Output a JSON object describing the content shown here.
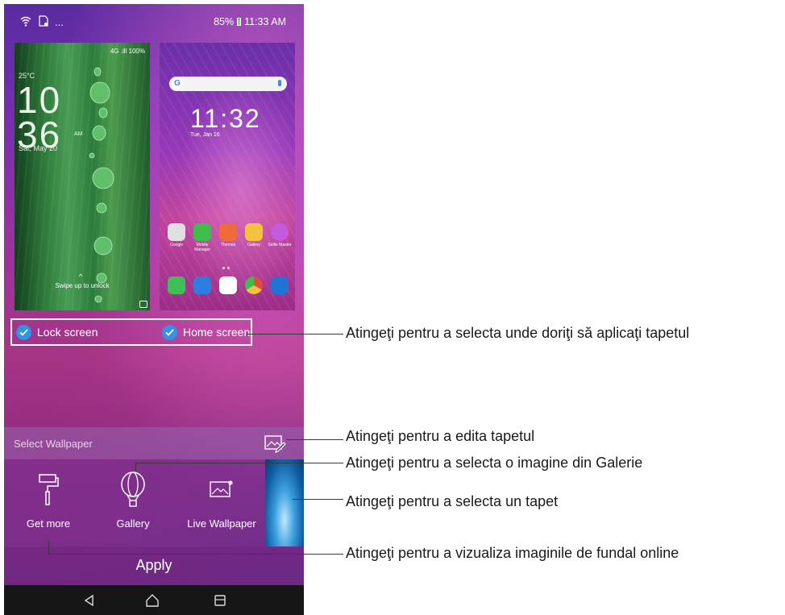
{
  "status_bar": {
    "left_icons": [
      "wifi-icon",
      "sd-card-icon",
      "more-icon"
    ],
    "more": "...",
    "battery": "85%",
    "time": "11:33 AM",
    "battery_color": "#7ee07a"
  },
  "lock_preview": {
    "status": "4G .ill 100%",
    "temperature": "25°C",
    "hour": "10",
    "minute": "36",
    "ampm": "AM",
    "date": "Sat, May 20",
    "unlock_hint": "Swipe up to unlock"
  },
  "home_preview": {
    "search_logo": "G",
    "clock": "11:32",
    "date": "Tue, Jan 16",
    "apps_row1": [
      {
        "label": "Google",
        "color": "#e0e0e0"
      },
      {
        "label": "Mobile Manager",
        "color": "#3ebd4c"
      },
      {
        "label": "Themes",
        "color": "#ef6b3a"
      },
      {
        "label": "Gallery",
        "color": "#f4c23f"
      },
      {
        "label": "Selfie Master",
        "color": "#c25be0"
      }
    ],
    "apps_row2": [
      {
        "label": "Phone",
        "color": "#3fbf58"
      },
      {
        "label": "Messages",
        "color": "#2f7de0"
      },
      {
        "label": "Play Store",
        "color": "#ffffff"
      },
      {
        "label": "Chrome",
        "color": "#e34b3b"
      },
      {
        "label": "Camera",
        "color": "#1f74d6"
      }
    ]
  },
  "targets": {
    "lock_label": "Lock screen",
    "home_label": "Home screen",
    "check_color": "#2f93e6"
  },
  "select_bar": {
    "label": "Select Wallpaper"
  },
  "options": [
    {
      "label": "Get more",
      "icon": "paint-roller-icon"
    },
    {
      "label": "Gallery",
      "icon": "balloon-icon"
    },
    {
      "label": "Live Wallpaper",
      "icon": "live-image-icon"
    }
  ],
  "apply_label": "Apply",
  "annotations": {
    "targets": "Atingeţi pentru a selecta unde doriţi să aplicaţi tapetul",
    "edit": "Atingeţi pentru a edita tapetul",
    "gallery": "Atingeţi pentru a selecta o imagine din Galerie",
    "wallpaper": "Atingeţi pentru a selecta un tapet",
    "online": "Atingeţi pentru a vizualiza imaginile de fundal online"
  }
}
